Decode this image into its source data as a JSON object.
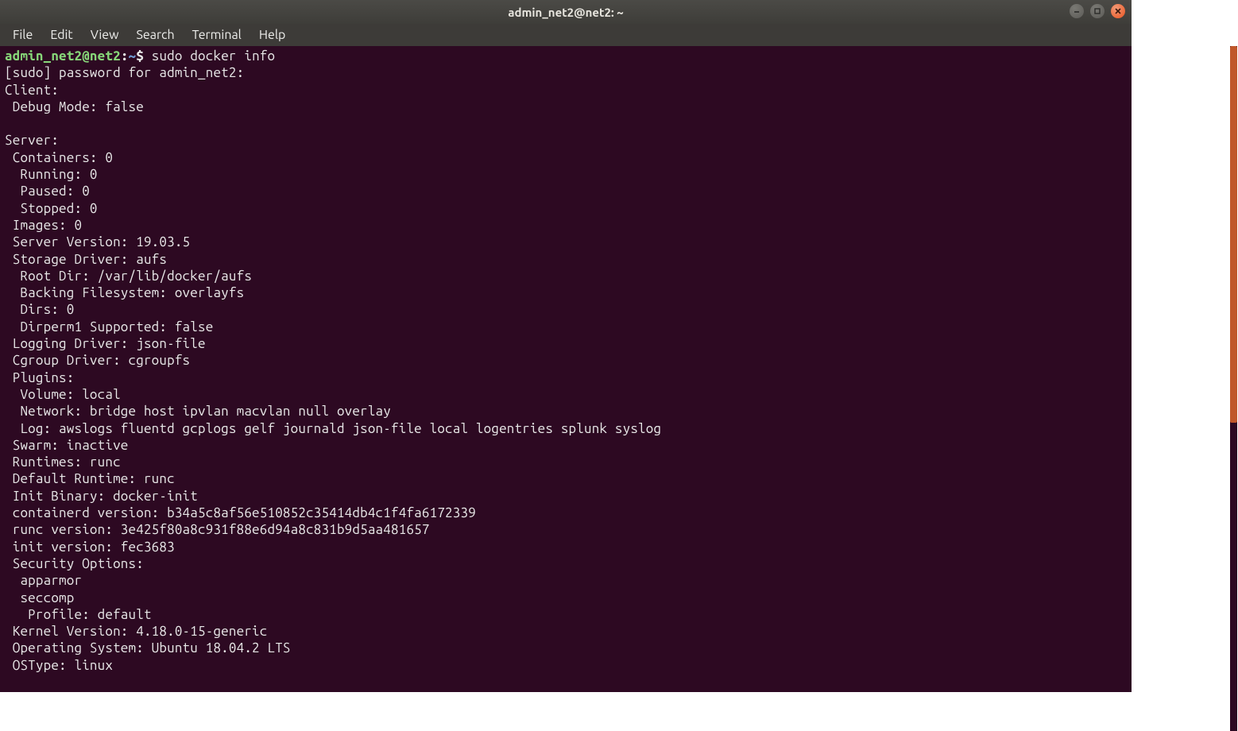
{
  "window": {
    "title": "admin_net2@net2: ~"
  },
  "menubar": {
    "items": [
      "File",
      "Edit",
      "View",
      "Search",
      "Terminal",
      "Help"
    ]
  },
  "prompt": {
    "userhost": "admin_net2@net2",
    "separator": ":",
    "path": "~",
    "dollar": "$",
    "command": " sudo docker info"
  },
  "lines": [
    "[sudo] password for admin_net2:",
    "Client:",
    " Debug Mode: false",
    "",
    "Server:",
    " Containers: 0",
    "  Running: 0",
    "  Paused: 0",
    "  Stopped: 0",
    " Images: 0",
    " Server Version: 19.03.5",
    " Storage Driver: aufs",
    "  Root Dir: /var/lib/docker/aufs",
    "  Backing Filesystem: overlayfs",
    "  Dirs: 0",
    "  Dirperm1 Supported: false",
    " Logging Driver: json-file",
    " Cgroup Driver: cgroupfs",
    " Plugins:",
    "  Volume: local",
    "  Network: bridge host ipvlan macvlan null overlay",
    "  Log: awslogs fluentd gcplogs gelf journald json-file local logentries splunk syslog",
    " Swarm: inactive",
    " Runtimes: runc",
    " Default Runtime: runc",
    " Init Binary: docker-init",
    " containerd version: b34a5c8af56e510852c35414db4c1f4fa6172339",
    " runc version: 3e425f80a8c931f88e6d94a8c831b9d5aa481657",
    " init version: fec3683",
    " Security Options:",
    "  apparmor",
    "  seccomp",
    "   Profile: default",
    " Kernel Version: 4.18.0-15-generic",
    " Operating System: Ubuntu 18.04.2 LTS",
    " OSType: linux"
  ]
}
